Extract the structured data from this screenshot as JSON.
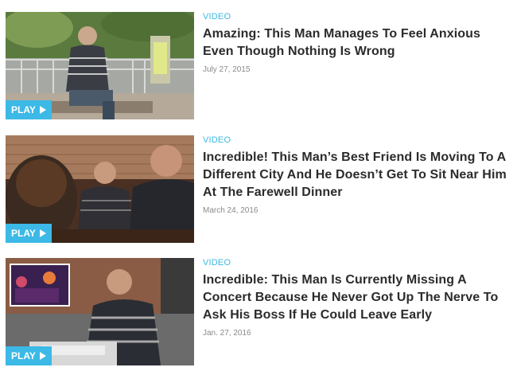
{
  "articles": [
    {
      "category": "VIDEO",
      "title": "Amazing: This Man Manages To Feel Anxious Even Though Nothing Is Wrong",
      "date": "July 27, 2015",
      "play_label": "PLAY",
      "thumbnail_icon": "video-thumbnail-man-sitting-on-bench"
    },
    {
      "category": "VIDEO",
      "title": "Incredible! This Man’s Best Friend Is Moving To A Different City And He Doesn’t Get To Sit Near Him At The Farewell Dinner",
      "date": "March 24, 2016",
      "play_label": "PLAY",
      "thumbnail_icon": "video-thumbnail-dinner-group"
    },
    {
      "category": "VIDEO",
      "title": "Incredible: This Man Is Currently Missing A Concert Because He Never Got Up The Nerve To Ask His Boss If He Could Leave Early",
      "date": "Jan. 27, 2016",
      "play_label": "PLAY",
      "thumbnail_icon": "video-thumbnail-man-at-desk"
    }
  ],
  "colors": {
    "accent": "#3cb9e6",
    "title": "#2b2b2b",
    "date": "#8a8a8a"
  }
}
